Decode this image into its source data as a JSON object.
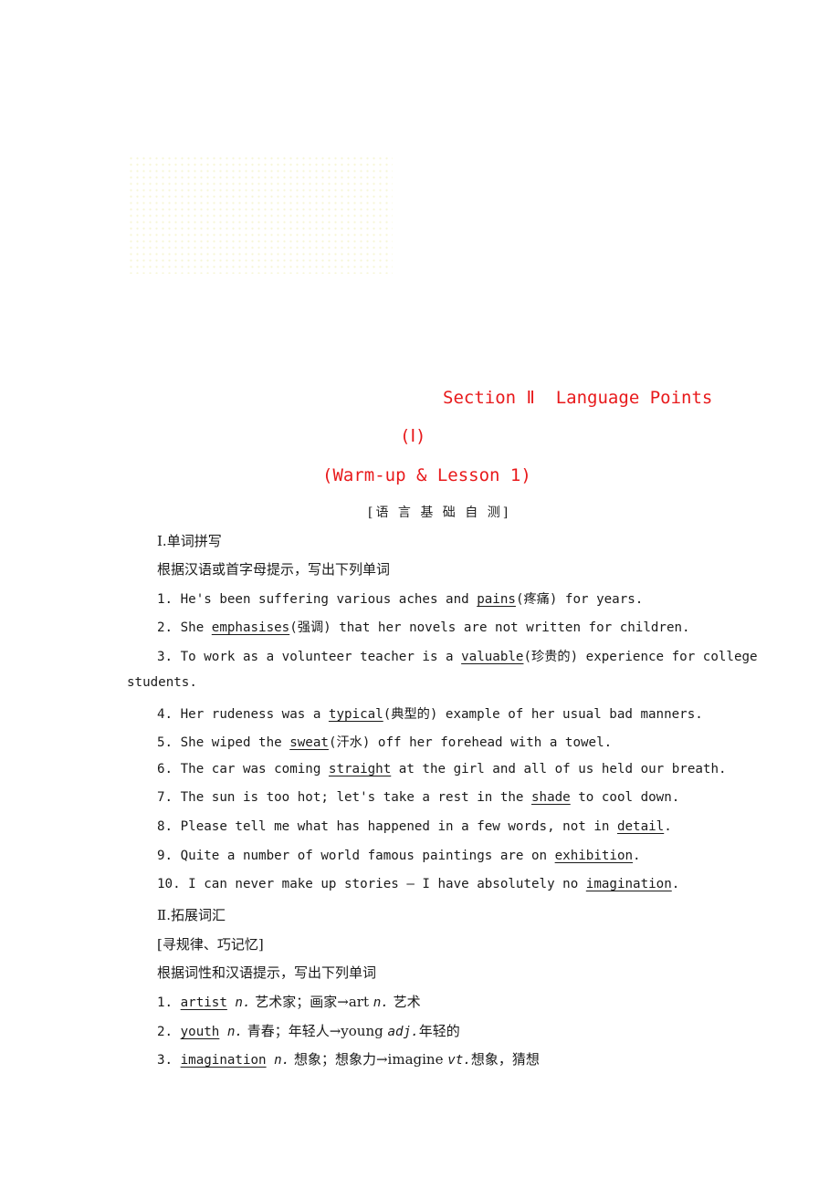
{
  "title": {
    "line1": "Section Ⅱ  Language Points",
    "line2": "(Ⅰ)",
    "line3": "(Warm-up & Lesson 1)"
  },
  "tag": "[语 言 基 础 自 测]",
  "part1": {
    "heading": "Ⅰ.单词拼写",
    "instruction": "根据汉语或首字母提示，写出下列单词",
    "items": [
      {
        "pre": "1. He's been suffering various aches and ",
        "answer": "pains",
        "post": "(疼痛) for years."
      },
      {
        "pre": "2. She ",
        "answer": "emphasises",
        "post": "(强调) that her novels are not written for children."
      },
      {
        "pre": "3. To work as a volunteer teacher is a ",
        "answer": "valuable",
        "post": "(珍贵的) experience for college",
        "cont": "students."
      },
      {
        "pre": "4. Her rudeness was a ",
        "answer": "typical",
        "post": "(典型的) example of her usual bad manners."
      },
      {
        "pre": "5. She wiped the ",
        "answer": "sweat",
        "post": "(汗水) off her forehead with a towel."
      },
      {
        "pre": "6. The car was coming ",
        "answer": "straight",
        "post": " at the girl and all of us held our breath."
      },
      {
        "pre": "7. The sun is too hot; let's take a rest in the ",
        "answer": "shade",
        "post": " to cool down."
      },
      {
        "pre": "8. Please tell me what has happened in a few words, not in ",
        "answer": "detail",
        "post": "."
      },
      {
        "pre": "9. Quite a number of world famous paintings are on ",
        "answer": "exhibition",
        "post": "."
      },
      {
        "pre": "10. I can never make up stories — I have absolutely no ",
        "answer": "imagination",
        "post": "."
      }
    ]
  },
  "part2": {
    "heading": "Ⅱ.拓展词汇",
    "subheading": "[寻规律、巧记忆]",
    "instruction": "根据词性和汉语提示，写出下列单词",
    "items": [
      {
        "num": "1. ",
        "answer": "artist",
        "pos": " n.",
        "meaning": " 艺术家；画家→art ",
        "pos2": "n.",
        "meaning2": " 艺术"
      },
      {
        "num": "2. ",
        "answer": "youth",
        "pos": " n.",
        "meaning": " 青春；年轻人→young ",
        "pos2": "adj.",
        "meaning2": "年轻的"
      },
      {
        "num": "3. ",
        "answer": "imagination",
        "pos": " n.",
        "meaning": " 想象；想象力→imagine ",
        "pos2": "vt.",
        "meaning2": "想象，猜想"
      }
    ]
  }
}
